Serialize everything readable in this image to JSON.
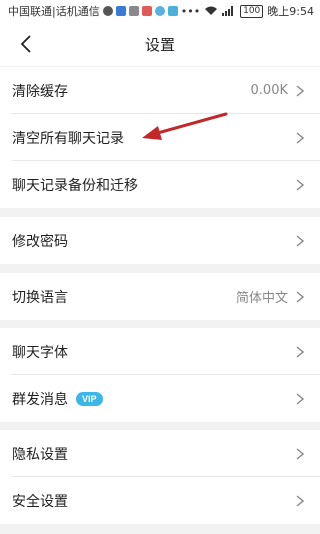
{
  "status_bar": {
    "carrier": "中国联通|话机通信",
    "battery": "100",
    "time": "晚上9:54"
  },
  "header": {
    "title": "设置"
  },
  "settings": {
    "clear_cache": {
      "label": "清除缓存",
      "value": "0.00K"
    },
    "clear_chats": {
      "label": "清空所有聊天记录"
    },
    "backup": {
      "label": "聊天记录备份和迁移"
    },
    "password": {
      "label": "修改密码"
    },
    "language": {
      "label": "切换语言",
      "value": "简体中文"
    },
    "font": {
      "label": "聊天字体"
    },
    "broadcast": {
      "label": "群发消息",
      "badge": "VIP"
    },
    "privacy": {
      "label": "隐私设置"
    },
    "security": {
      "label": "安全设置"
    }
  },
  "colors": {
    "annotation_arrow": "#c0282a",
    "vip_badge": "#3cb6e8"
  }
}
